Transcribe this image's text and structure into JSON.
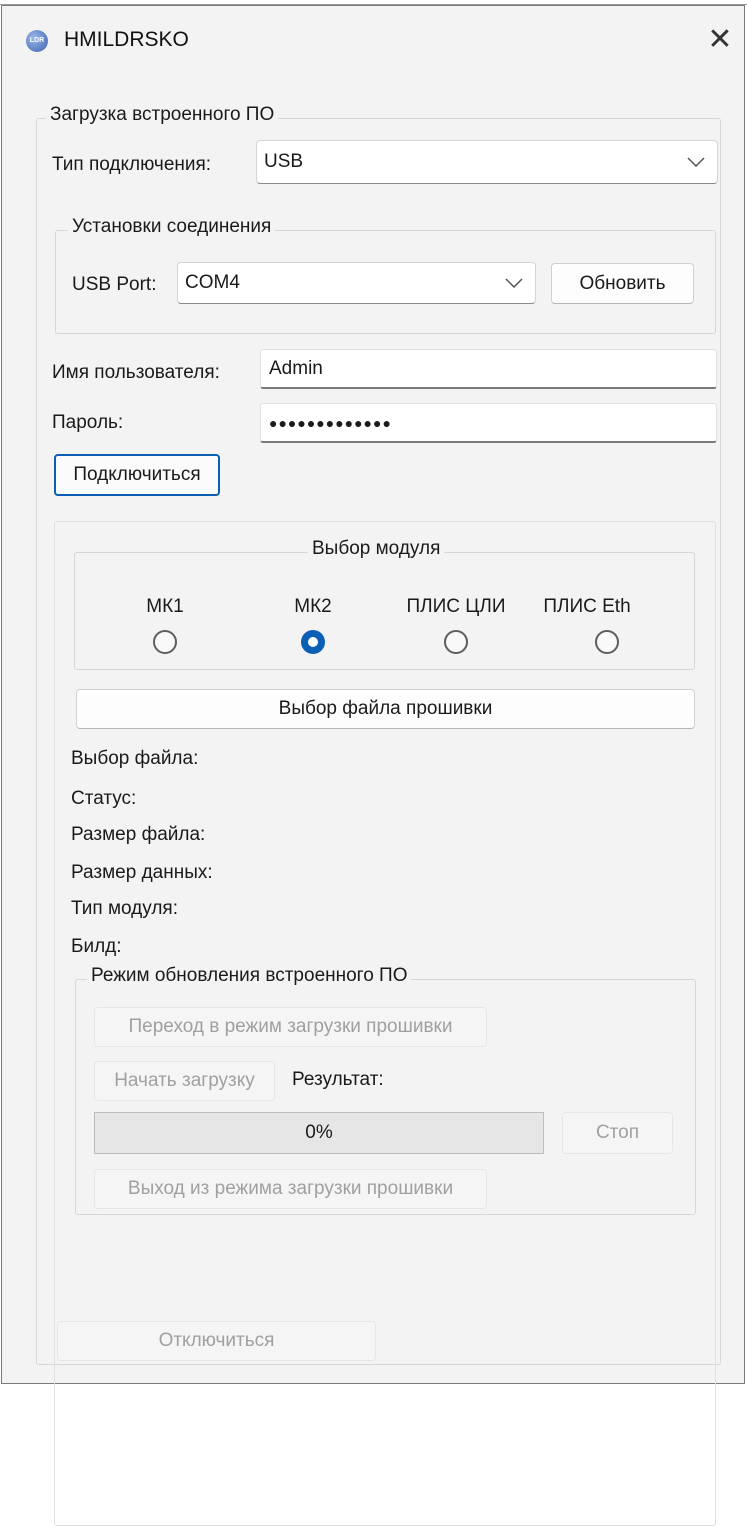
{
  "window": {
    "title": "HMILDRSKO",
    "icon_text": "LDR",
    "close_symbol": "✕"
  },
  "firmware_group": {
    "title": "Загрузка встроенного ПО",
    "connection_type_label": "Тип подключения:",
    "connection_type_value": "USB",
    "connection_settings": {
      "title": "Установки соединения",
      "port_label": "USB Port:",
      "port_value": "COM4",
      "refresh_label": "Обновить"
    },
    "username_label": "Имя пользователя:",
    "username_value": "Admin",
    "password_label": "Пароль:",
    "password_value": "●●●●●●●●●●●●●",
    "connect_label": "Подключиться"
  },
  "module_select": {
    "title": "Выбор модуля",
    "options": [
      {
        "label": "МК1",
        "checked": false
      },
      {
        "label": "МК2",
        "checked": true
      },
      {
        "label": "ПЛИС ЦЛИ",
        "checked": false
      },
      {
        "label": "ПЛИС Eth",
        "checked": false
      }
    ]
  },
  "firmware_file_button": "Выбор файла прошивки",
  "info": {
    "file": "Выбор файла:",
    "status": "Статус:",
    "file_size": "Размер файла:",
    "data_size": "Размер данных:",
    "module_type": "Тип модуля:",
    "build": "Билд:"
  },
  "update_mode": {
    "title": "Режим обновления встроенного ПО",
    "enter_mode_label": "Переход в режим загрузки прошивки",
    "start_label": "Начать загрузку",
    "result_label": "Результат:",
    "progress_text": "0%",
    "progress_value": 0,
    "stop_label": "Стоп",
    "exit_mode_label": "Выход из режима загрузки прошивки"
  },
  "disconnect_label": "Отключиться",
  "colors": {
    "accent": "#0b5fb5",
    "window_bg": "#f3f3f3",
    "disabled_text": "#a0a0a0"
  }
}
